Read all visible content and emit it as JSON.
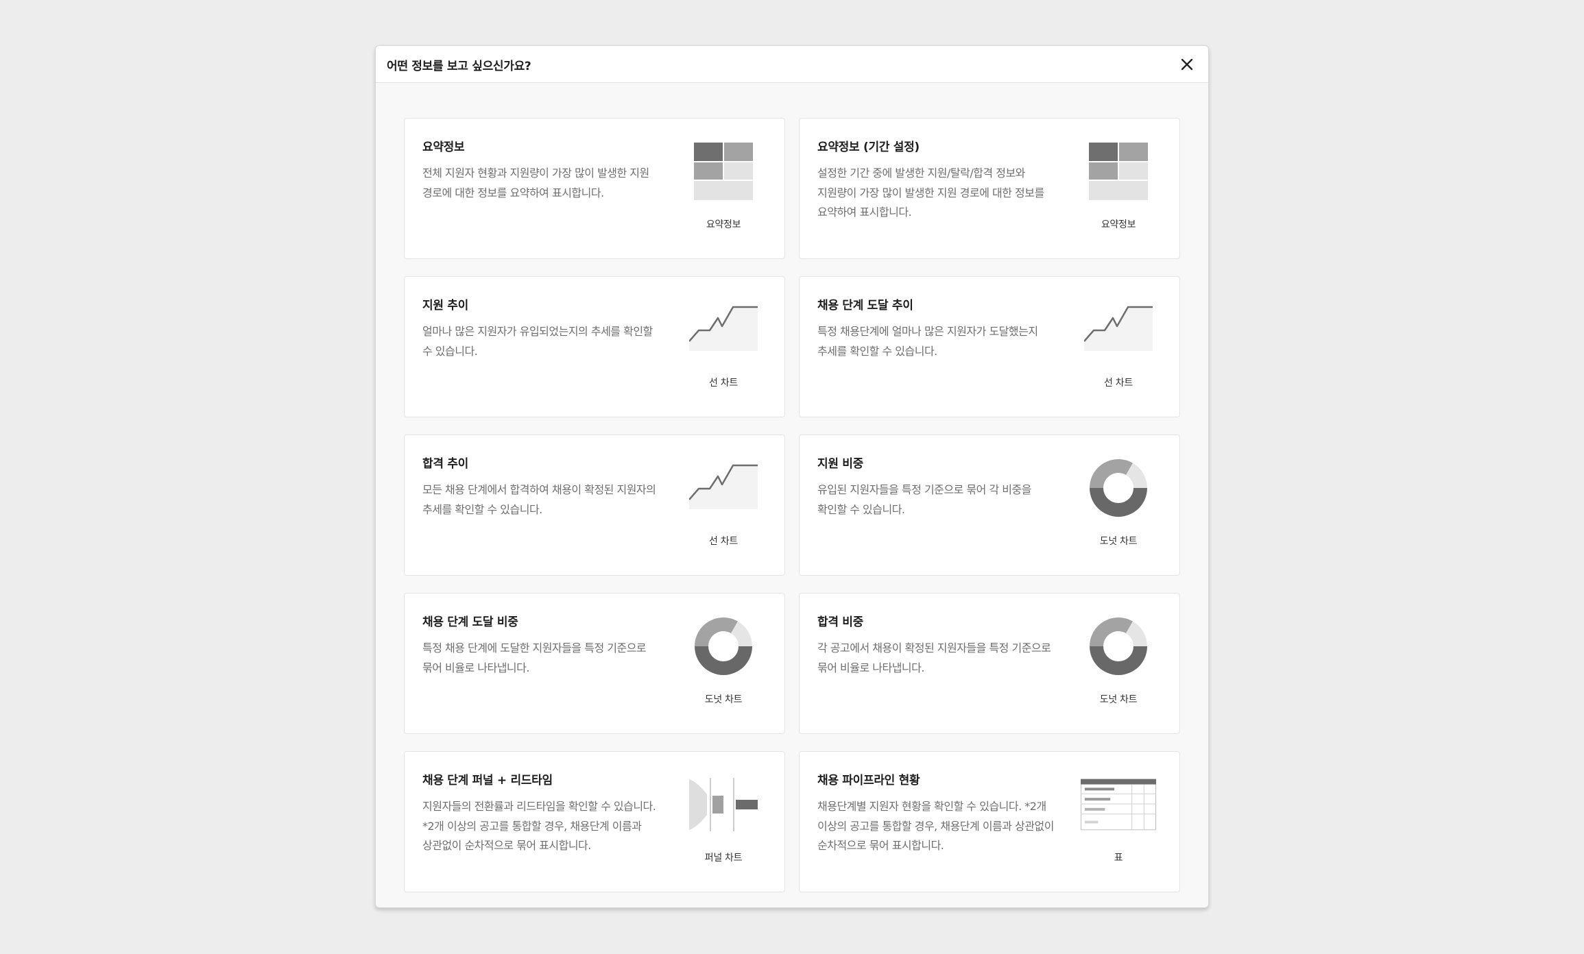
{
  "dialog": {
    "title": "어떤 정보를 보고 싶으신가요?",
    "close_icon": "close-icon"
  },
  "cards": [
    {
      "title": "요약정보",
      "description": "전체 지원자 현황과 지원량이 가장 많이 발생한 지원 경로에 대한 정보를 요약하여 표시합니다.",
      "icon": "summary-grid-icon",
      "caption": "요약정보"
    },
    {
      "title": "요약정보 (기간 설정)",
      "description": "설정한 기간 중에 발생한 지원/탈락/합격 정보와 지원량이 가장 많이 발생한 지원 경로에 대한 정보를 요약하여 표시합니다.",
      "icon": "summary-grid-icon",
      "caption": "요약정보"
    },
    {
      "title": "지원 추이",
      "description": "얼마나 많은 지원자가 유입되었는지의 추세를 확인할 수 있습니다.",
      "icon": "line-chart-icon",
      "caption": "선 차트"
    },
    {
      "title": "채용 단계 도달 추이",
      "description": "특정 채용단계에 얼마나 많은 지원자가 도달했는지 추세를 확인할 수 있습니다.",
      "icon": "line-chart-icon",
      "caption": "선 차트"
    },
    {
      "title": "합격 추이",
      "description": "모든 채용 단계에서 합격하여 채용이 확정된 지원자의 추세를 확인할 수 있습니다.",
      "icon": "line-chart-icon",
      "caption": "선 차트"
    },
    {
      "title": "지원 비중",
      "description": "유입된 지원자들을 특정 기준으로 묶어 각 비중을 확인할 수 있습니다.",
      "icon": "donut-chart-icon",
      "caption": "도넛 차트"
    },
    {
      "title": "채용 단계 도달 비중",
      "description": "특정 채용 단계에 도달한 지원자들을 특정 기준으로 묶어 비율로 나타냅니다.",
      "icon": "donut-chart-icon",
      "caption": "도넛 차트"
    },
    {
      "title": "합격 비중",
      "description": "각 공고에서 채용이 확정된 지원자들을 특정 기준으로 묶어 비율로 나타냅니다.",
      "icon": "donut-chart-icon",
      "caption": "도넛 차트"
    },
    {
      "title": "채용 단계 퍼널 + 리드타임",
      "description": "지원자들의 전환률과 리드타임을 확인할 수 있습니다. *2개 이상의 공고를 통합할 경우, 채용단계 이름과 상관없이 순차적으로 묶어 표시합니다.",
      "icon": "funnel-chart-icon",
      "caption": "퍼널 차트"
    },
    {
      "title": "채용 파이프라인 현황",
      "description": "채용단계별 지원자 현황을 확인할 수 있습니다. *2개 이상의 공고를 통합할 경우, 채용단계 이름과 상관없이 순차적으로 묶어 표시합니다.",
      "icon": "table-icon",
      "caption": "표"
    }
  ]
}
